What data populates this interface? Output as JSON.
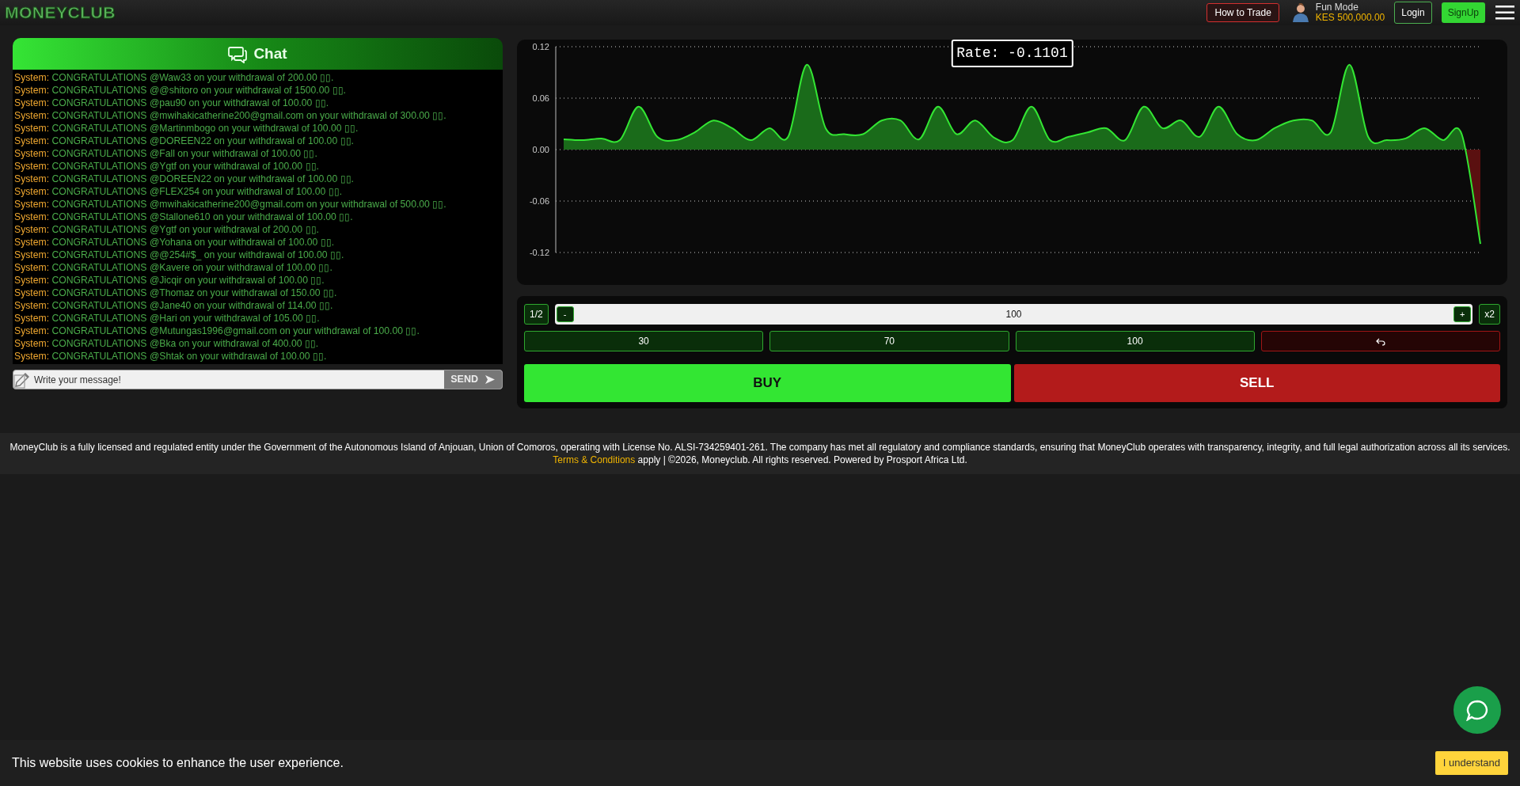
{
  "header": {
    "logo": "MONEYCLUB",
    "how_to_trade": "How to Trade",
    "mode": {
      "label": "Fun Mode",
      "balance": "KES 500,000.00"
    },
    "login": "Login",
    "signup": "SignUp"
  },
  "chat": {
    "title": "Chat",
    "messages": [
      {
        "sender": "System:",
        "text": "CONGRATULATIONS @Waw33 on your withdrawal of 200.00 ▯▯."
      },
      {
        "sender": "System:",
        "text": "CONGRATULATIONS @@shitoro on your withdrawal of 1500.00 ▯▯."
      },
      {
        "sender": "System:",
        "text": "CONGRATULATIONS @pau90 on your withdrawal of 100.00 ▯▯."
      },
      {
        "sender": "System:",
        "text": "CONGRATULATIONS @mwihakicatherine200@gmail.com on your withdrawal of 300.00 ▯▯."
      },
      {
        "sender": "System:",
        "text": "CONGRATULATIONS @Martinmbogo on your withdrawal of 100.00 ▯▯."
      },
      {
        "sender": "System:",
        "text": "CONGRATULATIONS @DOREEN22 on your withdrawal of 100.00 ▯▯."
      },
      {
        "sender": "System:",
        "text": "CONGRATULATIONS @Fall on your withdrawal of 100.00 ▯▯."
      },
      {
        "sender": "System:",
        "text": "CONGRATULATIONS @Ygtf on your withdrawal of 100.00 ▯▯."
      },
      {
        "sender": "System:",
        "text": "CONGRATULATIONS @DOREEN22 on your withdrawal of 100.00 ▯▯."
      },
      {
        "sender": "System:",
        "text": "CONGRATULATIONS @FLEX254 on your withdrawal of 100.00 ▯▯."
      },
      {
        "sender": "System:",
        "text": "CONGRATULATIONS @mwihakicatherine200@gmail.com on your withdrawal of 500.00 ▯▯."
      },
      {
        "sender": "System:",
        "text": "CONGRATULATIONS @Stallone610 on your withdrawal of 100.00 ▯▯."
      },
      {
        "sender": "System:",
        "text": "CONGRATULATIONS @Ygtf on your withdrawal of 200.00 ▯▯."
      },
      {
        "sender": "System:",
        "text": "CONGRATULATIONS @Yohana on your withdrawal of 100.00 ▯▯."
      },
      {
        "sender": "System:",
        "text": "CONGRATULATIONS @@254#$_ on your withdrawal of 100.00 ▯▯."
      },
      {
        "sender": "System:",
        "text": "CONGRATULATIONS @Kavere on your withdrawal of 100.00 ▯▯."
      },
      {
        "sender": "System:",
        "text": "CONGRATULATIONS @Jicqir on your withdrawal of 100.00 ▯▯."
      },
      {
        "sender": "System:",
        "text": "CONGRATULATIONS @Thomaz on your withdrawal of 150.00 ▯▯."
      },
      {
        "sender": "System:",
        "text": "CONGRATULATIONS @Jane40 on your withdrawal of 114.00 ▯▯."
      },
      {
        "sender": "System:",
        "text": "CONGRATULATIONS @Hari on your withdrawal of 105.00 ▯▯."
      },
      {
        "sender": "System:",
        "text": "CONGRATULATIONS @Mutungas1996@gmail.com on your withdrawal of 100.00 ▯▯."
      },
      {
        "sender": "System:",
        "text": "CONGRATULATIONS @Bka on your withdrawal of 400.00 ▯▯."
      },
      {
        "sender": "System:",
        "text": "CONGRATULATIONS @Shtak on your withdrawal of 100.00 ▯▯."
      }
    ],
    "input": {
      "placeholder": "Write your message!"
    },
    "send": "SEND"
  },
  "chart": {
    "rate": "Rate: -0.1101",
    "chart_data": {
      "type": "area",
      "ylim": [
        -0.12,
        0.12
      ],
      "yticks": [
        {
          "value": 0.12,
          "label": "0.12"
        },
        {
          "value": 0.06,
          "label": "0.06"
        },
        {
          "value": 0,
          "label": "0.00"
        },
        {
          "value": -0.06,
          "label": "-0.06"
        },
        {
          "value": -0.12,
          "label": "-0.12"
        }
      ],
      "grid": true,
      "values": [
        0.012,
        0.011,
        0.013,
        0.011,
        0.05,
        0.015,
        0.011,
        0.02,
        0.034,
        0.025,
        0.011,
        0.025,
        0.015,
        0.099,
        0.025,
        0.018,
        0.018,
        0.034,
        0.034,
        0.012,
        0.05,
        0.018,
        0.034,
        0.014,
        0.011,
        0.05,
        0.011,
        0.015,
        0.02,
        0.025,
        0.011,
        0.05,
        0.025,
        0.034,
        0.015,
        0.05,
        0.018,
        0.011,
        0.025,
        0.034,
        0.034,
        0.02,
        0.099,
        0.015,
        0.011,
        0.013,
        0.025,
        0.011,
        0.018,
        -0.11
      ]
    }
  },
  "trade": {
    "half": "1/2",
    "minus": "-",
    "amount": "100",
    "plus": "+",
    "double": "x2",
    "presets": [
      "30",
      "70",
      "100"
    ],
    "buy": "BUY",
    "sell": "SELL"
  },
  "footer": {
    "text": "MoneyClub is a fully licensed and regulated entity under the Government of the Autonomous Island of Anjouan, Union of Comoros, operating with License No. ALSI-734259401-261. The company has met all regulatory and compliance standards, ensuring that MoneyClub operates with transparency, integrity, and full legal authorization across all its services.",
    "link": "Terms & Conditions",
    "rest": "apply | ©2026, Moneyclub. All rights reserved. Powered by Prosport Africa Ltd."
  },
  "cookie": {
    "text": "This website uses cookies to enhance the user experience.",
    "button": "I understand"
  }
}
